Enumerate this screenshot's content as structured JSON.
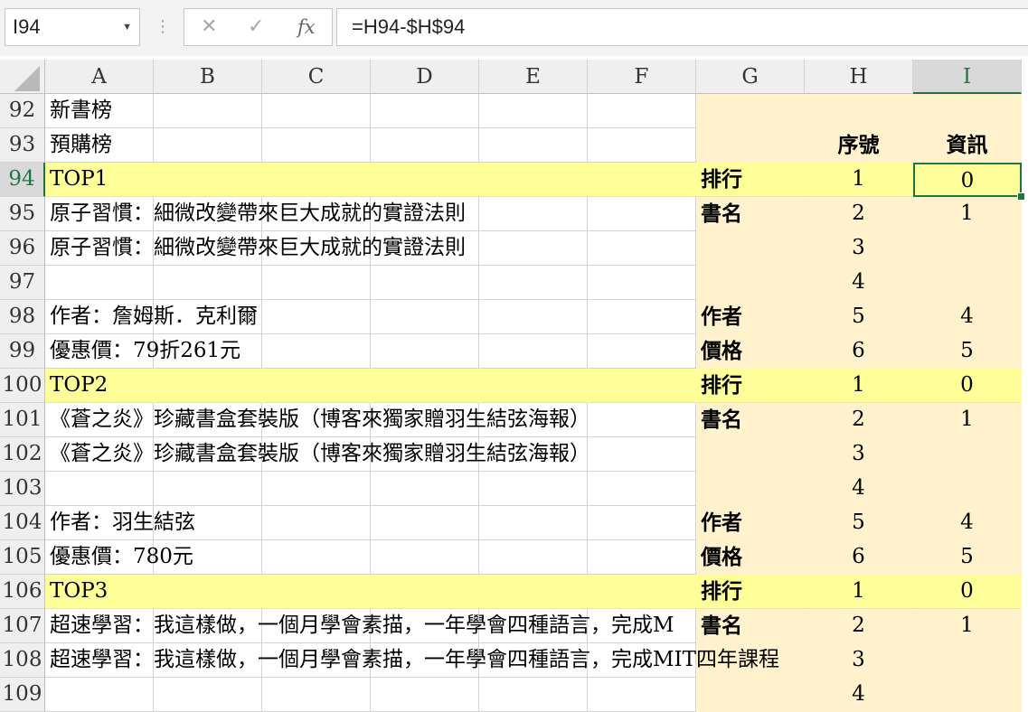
{
  "name_box": {
    "value": "I94"
  },
  "formula_bar": {
    "formula": "=H94-$H$94",
    "cancel_icon": "✕",
    "enter_icon": "✓",
    "fx_label": "fx"
  },
  "columns": [
    "A",
    "B",
    "C",
    "D",
    "E",
    "F",
    "G",
    "H",
    "I"
  ],
  "selected_cell": "I94",
  "colors": {
    "yellow": "#ffff99",
    "tan": "#fff2cc",
    "selection": "#217346"
  },
  "rows": [
    {
      "n": "92",
      "A": "新書榜",
      "G": "",
      "H": "",
      "I": "",
      "style": "plain"
    },
    {
      "n": "93",
      "A": "預購榜",
      "G": "",
      "H": "序號",
      "I": "資訊",
      "style": "plain",
      "bold_hi": true
    },
    {
      "n": "94",
      "A": "TOP1",
      "G": "排行",
      "H": "1",
      "I": "0",
      "style": "yellow"
    },
    {
      "n": "95",
      "A": "原子習慣：細微改變帶來巨大成就的實證法則",
      "G": "書名",
      "H": "2",
      "I": "1",
      "style": "plain"
    },
    {
      "n": "96",
      "A": "原子習慣：細微改變帶來巨大成就的實證法則",
      "G": "",
      "H": "3",
      "I": "",
      "style": "plain"
    },
    {
      "n": "97",
      "A": "",
      "G": "",
      "H": "4",
      "I": "",
      "style": "plain"
    },
    {
      "n": "98",
      "A": "作者：詹姆斯．克利爾",
      "G": "作者",
      "H": "5",
      "I": "4",
      "style": "plain"
    },
    {
      "n": "99",
      "A": "優惠價：79折261元",
      "G": "價格",
      "H": "6",
      "I": "5",
      "style": "plain"
    },
    {
      "n": "100",
      "A": "TOP2",
      "G": "排行",
      "H": "1",
      "I": "0",
      "style": "yellow"
    },
    {
      "n": "101",
      "A": "《蒼之炎》珍藏書盒套裝版（博客來獨家贈羽生結弦海報）",
      "G": "書名",
      "H": "2",
      "I": "1",
      "style": "plain"
    },
    {
      "n": "102",
      "A": "《蒼之炎》珍藏書盒套裝版（博客來獨家贈羽生結弦海報）",
      "G": "",
      "H": "3",
      "I": "",
      "style": "plain"
    },
    {
      "n": "103",
      "A": "",
      "G": "",
      "H": "4",
      "I": "",
      "style": "plain"
    },
    {
      "n": "104",
      "A": "作者：羽生結弦",
      "G": "作者",
      "H": "5",
      "I": "4",
      "style": "plain"
    },
    {
      "n": "105",
      "A": "優惠價：780元",
      "G": "價格",
      "H": "6",
      "I": "5",
      "style": "plain"
    },
    {
      "n": "106",
      "A": "TOP3",
      "G": "排行",
      "H": "1",
      "I": "0",
      "style": "yellow"
    },
    {
      "n": "107",
      "A": "超速學習：我這樣做，一個月學會素描，一年學會四種語言，完成M",
      "G": "書名",
      "H": "2",
      "I": "1",
      "style": "plain"
    },
    {
      "n": "108",
      "A": "超速學習：我這樣做，一個月學會素描，一年學會四種語言，完成MIT四年課程",
      "G": "",
      "H": "3",
      "I": "",
      "style": "plain",
      "overflow_g": true
    },
    {
      "n": "109",
      "A": "",
      "G": "",
      "H": "4",
      "I": "",
      "style": "plain"
    }
  ]
}
